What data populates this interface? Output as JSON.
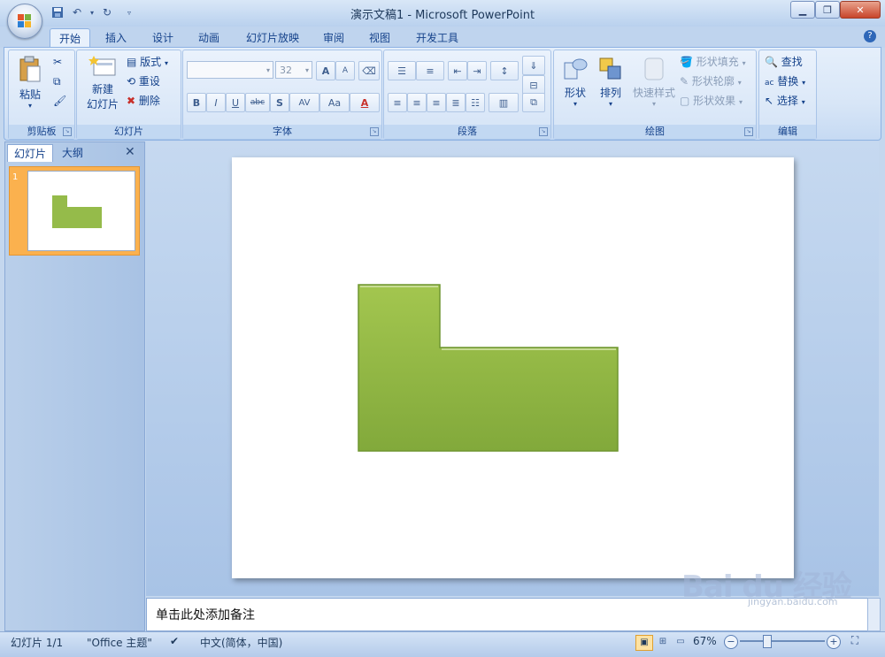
{
  "window": {
    "title": "演示文稿1 - Microsoft PowerPoint",
    "minimize_icon": "minimize-icon",
    "maximize_icon": "maximize-icon",
    "close_icon": "close-icon"
  },
  "qat": {
    "save_icon": "save-icon",
    "undo_icon": "undo-icon",
    "redo_icon": "redo-icon",
    "customize_icon": "customize-qat-icon"
  },
  "tabs": [
    "开始",
    "插入",
    "设计",
    "动画",
    "幻灯片放映",
    "审阅",
    "视图",
    "开发工具"
  ],
  "ribbon": {
    "clipboard": {
      "paste": "粘贴",
      "label": "剪贴板"
    },
    "slides": {
      "new_slide_line1": "新建",
      "new_slide_line2": "幻灯片",
      "layout": "版式",
      "reset": "重设",
      "delete": "删除",
      "label": "幻灯片"
    },
    "font": {
      "font_name": "",
      "font_size": "32",
      "label": "字体",
      "bold": "B",
      "italic": "I",
      "underline": "U",
      "strike": "abc",
      "shadow": "S",
      "spacing": "AV",
      "case": "Aa",
      "color": "A",
      "grow": "A",
      "shrink": "A"
    },
    "paragraph": {
      "label": "段落"
    },
    "drawing": {
      "shapes": "形状",
      "arrange": "排列",
      "quick_styles": "快速样式",
      "shape_fill": "形状填充",
      "shape_outline": "形状轮廓",
      "shape_effects": "形状效果",
      "label": "绘图"
    },
    "editing": {
      "find": "查找",
      "replace": "替换",
      "select": "选择",
      "label": "编辑"
    }
  },
  "panel": {
    "tab_slides": "幻灯片",
    "tab_outline": "大纲",
    "slide_number": "1"
  },
  "notes": {
    "placeholder": "单击此处添加备注"
  },
  "status": {
    "slide_info": "幻灯片 1/1",
    "theme": "\"Office 主题\"",
    "language": "中文(简体，中国)",
    "zoom": "67%"
  },
  "watermark": {
    "main": "Bai du 经验",
    "sub": "jingyan.baidu.com"
  },
  "colors": {
    "shape_fill": "#95bb4a",
    "accent": "#15428b"
  }
}
